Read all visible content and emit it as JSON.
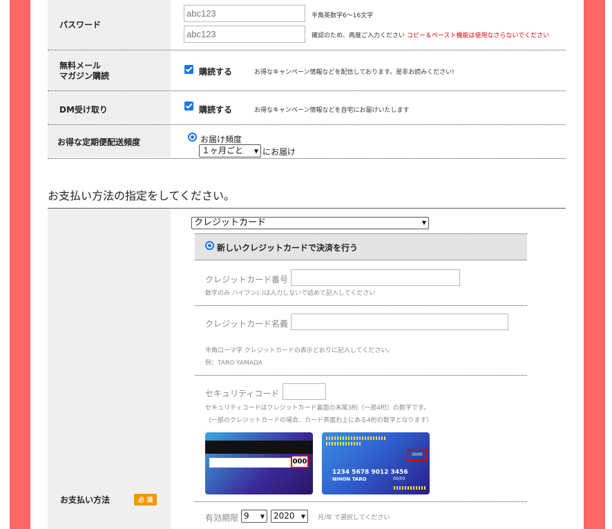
{
  "password": {
    "label": "パスワード",
    "value1": "abc123",
    "hint1": "半角英数字6〜16文字",
    "value2": "abc123",
    "hint2": "確認のため、再度ご入力ください",
    "warning": "コピー＆ペースト機能は使用なさらないでください"
  },
  "mailmag": {
    "label_line1": "無料メール",
    "label_line2": "マガジン購読",
    "checkbox_label": "購読する",
    "note": "お得なキャンペーン情報などを配信しております。是非お読みください!"
  },
  "dm": {
    "label": "DM受け取り",
    "checkbox_label": "購読する",
    "note": "お得なキャンペーン情報などを自宅にお届けいたします"
  },
  "delivery": {
    "label": "お得な定期便配送頻度",
    "radio_label": "お届け頻度",
    "frequency_selected": "１ヶ月ごと",
    "suffix": "にお届け"
  },
  "payment": {
    "heading": "お支払い方法の指定をしてください。",
    "label": "お支払い方法",
    "required_badge": "必 須",
    "method_selected": "クレジットカード",
    "new_card_option": "新しいクレジットカードで決済を行う",
    "card_number_label": "クレジットカード番号",
    "card_number_note": "数字のみ ハイフン(-)は入力しないで詰めて記入してください",
    "card_name_label": "クレジットカード名義",
    "card_name_note1": "半角ローマ字 クレジットカードの表示どおりに記入してください。",
    "card_name_note2": "例：TARO YAMADA",
    "security_label": "セキュリティコード",
    "security_note1": "セキュリティコードはクレジットカード裏面の末尾3桁（一部4桁）の数字です。",
    "security_note2": "（一部のクレジットカードの場合、カード表面右上にある4桁の数字となります）",
    "card_back_code": "000",
    "card_front_code": "0000",
    "card_front_number": "1234  5678  9012  3456",
    "card_front_name": "NIHON TARO",
    "card_front_expiry": "00/00",
    "expiry_label": "有効期限",
    "expiry_month": "9",
    "expiry_year": "2020",
    "expiry_note": "月/年 で選択してください"
  }
}
